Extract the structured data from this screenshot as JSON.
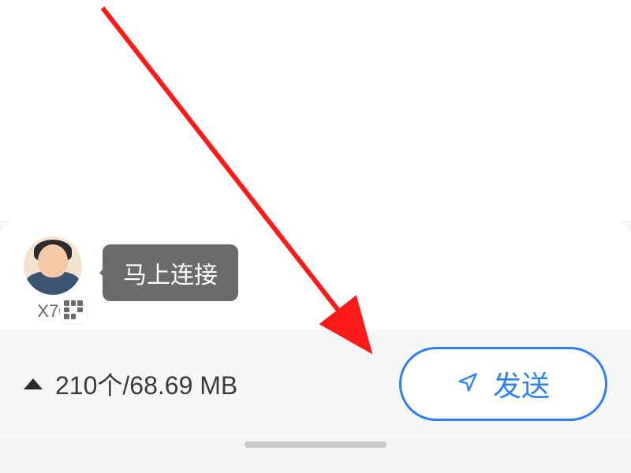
{
  "device": {
    "name": "X70",
    "tooltip_label": "马上连接"
  },
  "summary": {
    "count_label": "210个/68.69 MB"
  },
  "actions": {
    "send_label": "发送"
  },
  "colors": {
    "accent": "#2f80ed",
    "tooltip_bg": "#6b6b6b",
    "annotation_red": "#ff1a1a"
  },
  "icons": {
    "avatar": "person-avatar",
    "qr": "qr-code-icon",
    "expand": "chevron-up-icon",
    "send": "paper-plane-icon"
  }
}
